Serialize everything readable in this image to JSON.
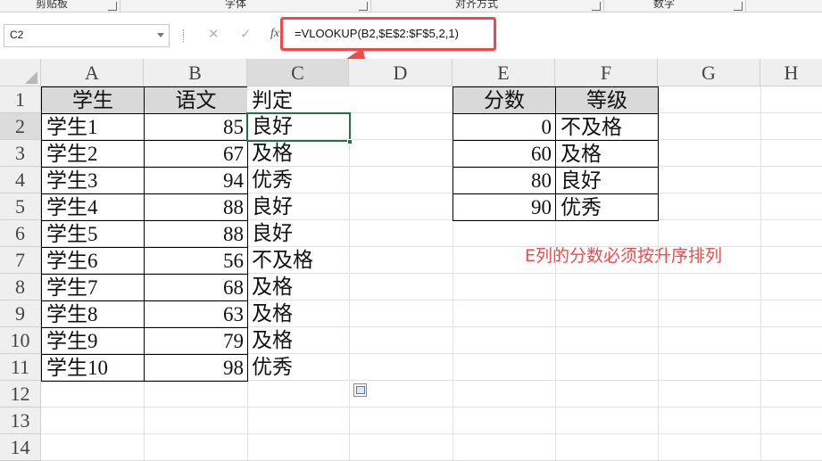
{
  "ribbon": {
    "groups": [
      "剪贴板",
      "字体",
      "对齐方式",
      "数字"
    ]
  },
  "formula_bar": {
    "name_box": "C2",
    "cancel_icon": "close-icon",
    "enter_icon": "check-icon",
    "function_icon": "fx-icon",
    "function_glyph": "fx",
    "formula": "=VLOOKUP(B2,$E$2:$F$5,2,1)"
  },
  "columns": [
    "A",
    "B",
    "C",
    "D",
    "E",
    "F",
    "G",
    "H"
  ],
  "rows": [
    "1",
    "2",
    "3",
    "4",
    "5",
    "6",
    "7",
    "8",
    "9",
    "10",
    "11",
    "12",
    "13",
    "14"
  ],
  "selected": {
    "column": "C",
    "row": "2"
  },
  "table_main": {
    "headers": [
      "学生",
      "语文",
      "判定"
    ],
    "rows": [
      [
        "学生1",
        "85",
        "良好"
      ],
      [
        "学生2",
        "67",
        "及格"
      ],
      [
        "学生3",
        "94",
        "优秀"
      ],
      [
        "学生4",
        "88",
        "良好"
      ],
      [
        "学生5",
        "88",
        "良好"
      ],
      [
        "学生6",
        "56",
        "不及格"
      ],
      [
        "学生7",
        "68",
        "及格"
      ],
      [
        "学生8",
        "63",
        "及格"
      ],
      [
        "学生9",
        "79",
        "及格"
      ],
      [
        "学生10",
        "98",
        "优秀"
      ]
    ]
  },
  "table_lookup": {
    "headers": [
      "分数",
      "等级"
    ],
    "rows": [
      [
        "0",
        "不及格"
      ],
      [
        "60",
        "及格"
      ],
      [
        "80",
        "良好"
      ],
      [
        "90",
        "优秀"
      ]
    ]
  },
  "annotation": "E列的分数必须按升序排列",
  "colors": {
    "accent_red": "#ef4a4a",
    "header_fill": "#d9d9d9",
    "selection_green": "#217346"
  }
}
